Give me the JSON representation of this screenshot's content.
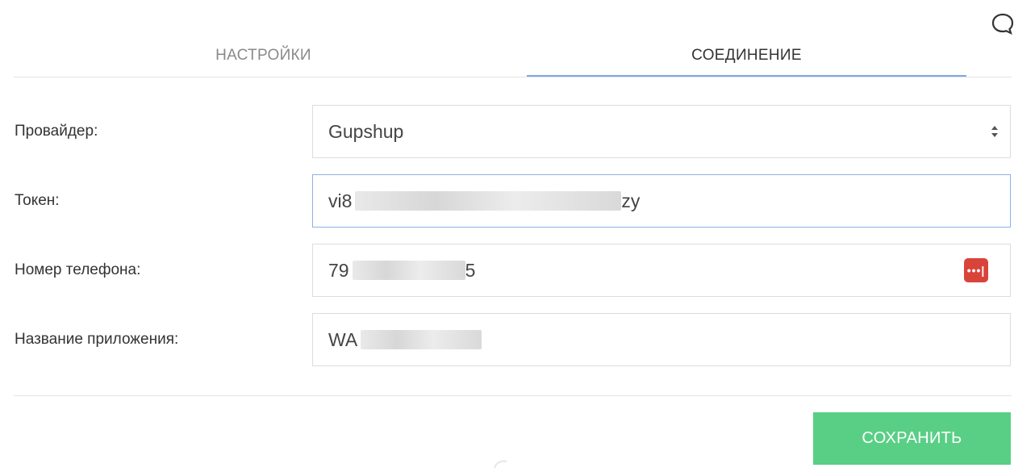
{
  "tabs": {
    "settings_label": "НАСТРОЙКИ",
    "connection_label": "СОЕДИНЕНИЕ",
    "active": "connection"
  },
  "form": {
    "provider": {
      "label": "Провайдер:",
      "value": "Gupshup"
    },
    "token": {
      "label": "Токен:",
      "value_visible_start": "vi8",
      "value_visible_end": "zy",
      "masked": true
    },
    "phone": {
      "label": "Номер телефона:",
      "value_visible_start": "79",
      "value_visible_end": "5",
      "masked": true
    },
    "app_name": {
      "label": "Название приложения:",
      "value_visible_start": "WA",
      "masked": true
    }
  },
  "actions": {
    "save_label": "СОХРАНИТЬ"
  },
  "colors": {
    "accent_underline": "#7ea7e8",
    "save_button": "#59cf85",
    "password_manager_icon": "#d9443a"
  },
  "icons": [
    "chat-bubble-icon",
    "select-arrows-icon",
    "password-manager-icon"
  ]
}
